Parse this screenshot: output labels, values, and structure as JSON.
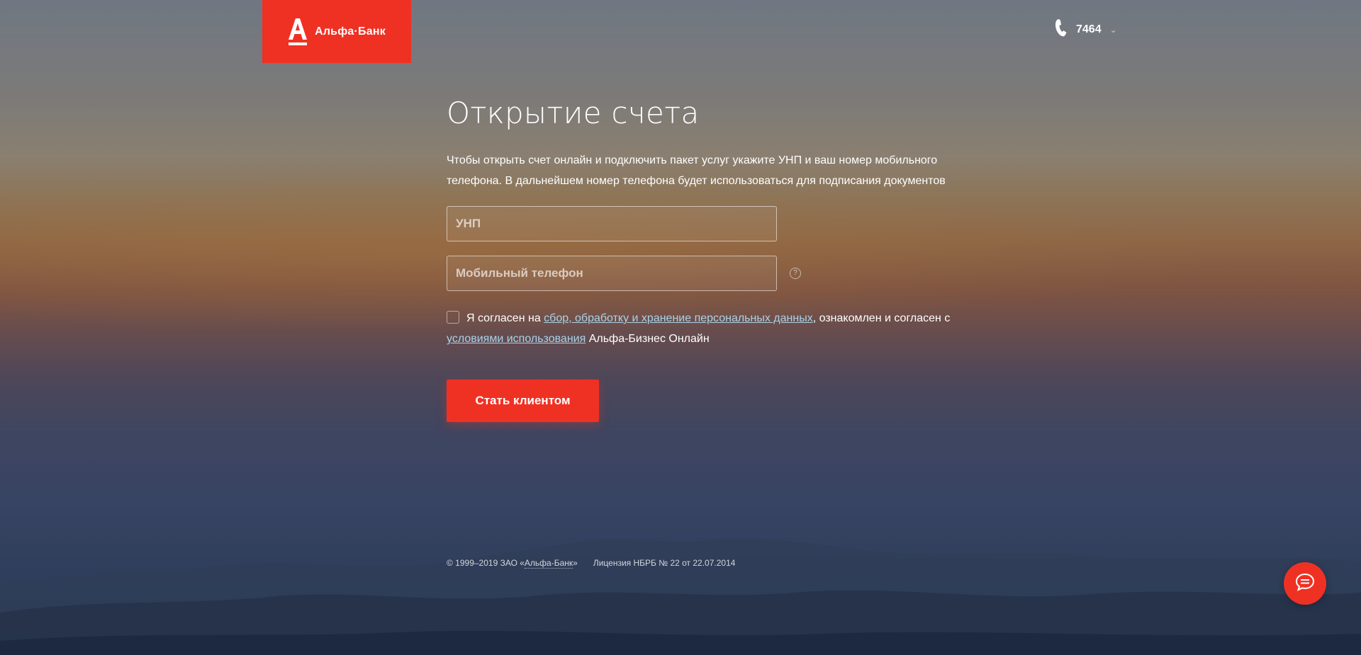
{
  "header": {
    "logo_text": "Альфа·Банк",
    "phone_number": "7464",
    "phone_chevron": "⌄"
  },
  "form": {
    "title": "Открытие счета",
    "intro": "Чтобы открыть счет онлайн и подключить пакет услуг укажите УНП и ваш номер мобильного телефона. В дальнейшем номер телефона будет использоваться для подписания документов",
    "unp_placeholder": "УНП",
    "phone_placeholder": "Мобильный телефон",
    "help_glyph": "?",
    "consent_prefix": "Я согласен на ",
    "consent_link_data": "сбор, обработку и хранение персональных данных",
    "consent_middle": ", ознакомлен и согласен с ",
    "consent_link_terms": "условиями использования",
    "consent_suffix": " Альфа-Бизнес Онлайн",
    "submit_label": "Стать клиентом"
  },
  "footer": {
    "copyright_prefix": "© 1999–2019 ЗАО «",
    "copyright_brand": "Альфа-Банк",
    "copyright_suffix": "»",
    "license": "Лицензия НБРБ № 22 от 22.07.2014"
  },
  "icons": {
    "logo": "alfa-a-icon",
    "phone": "phone-handset-icon",
    "chat": "chat-bubble-icon"
  },
  "colors": {
    "brand_red": "#ef3124",
    "link": "#a9d2e8"
  }
}
